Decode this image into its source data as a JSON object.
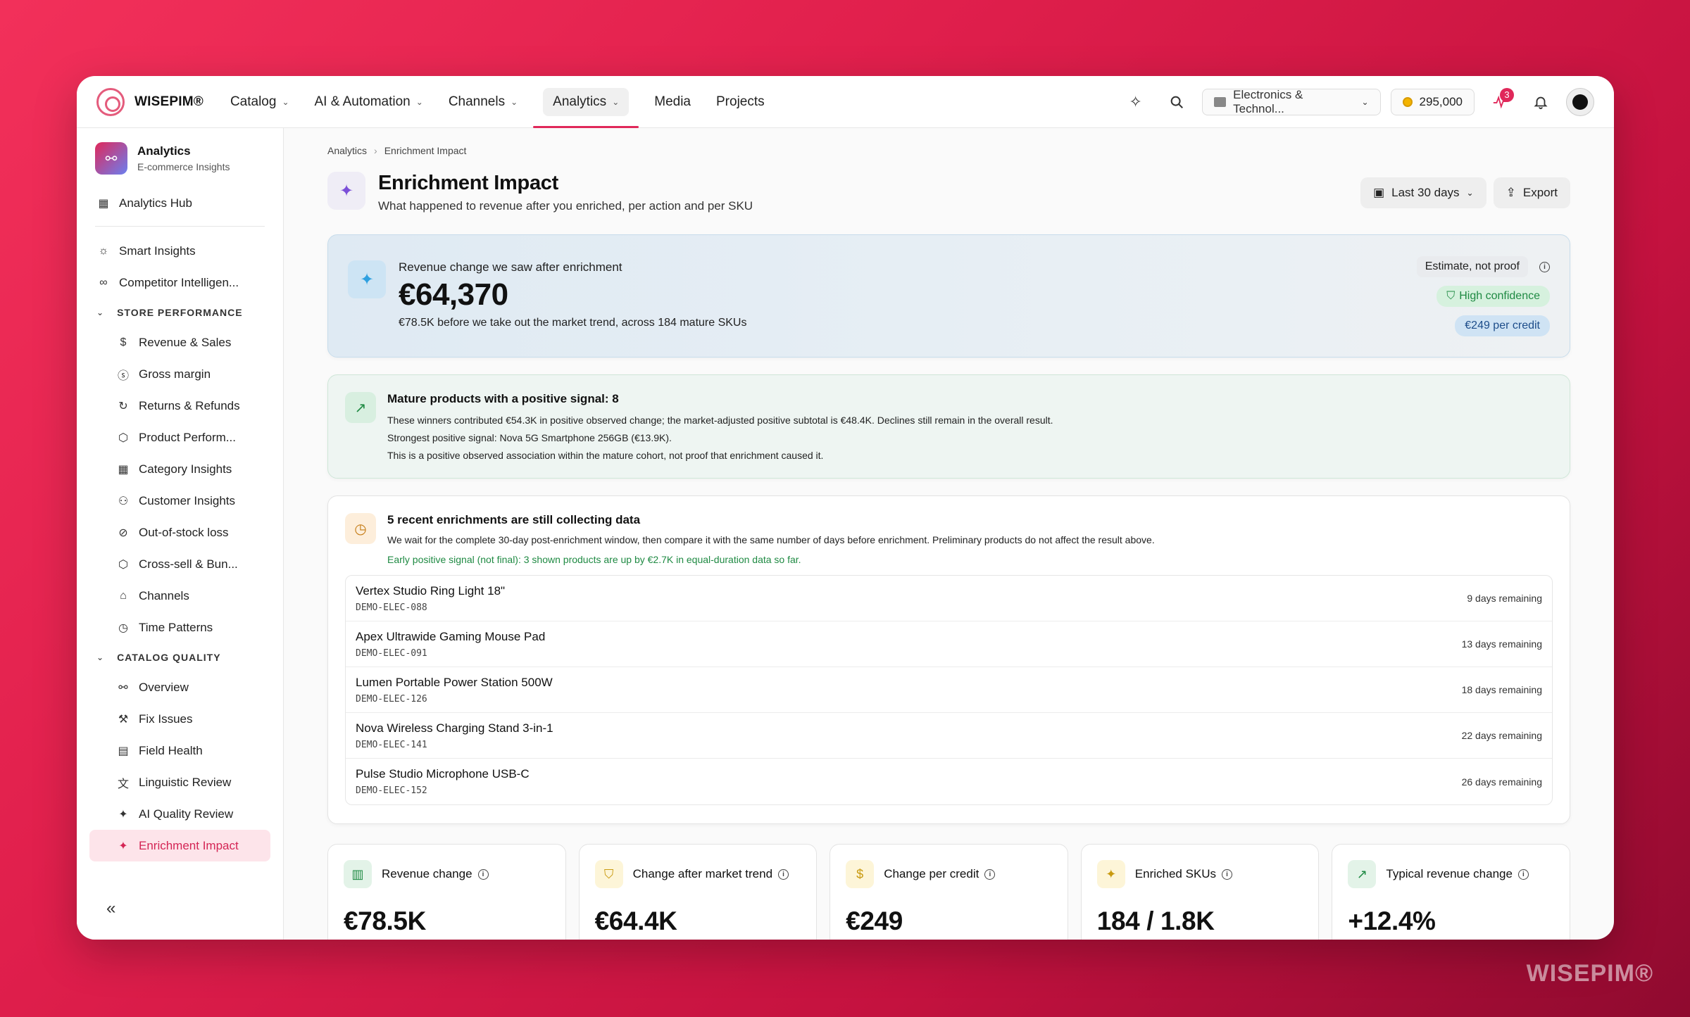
{
  "brand": {
    "name": "WISEPIM®"
  },
  "watermark": "WISEPIM®",
  "nav": {
    "items": [
      {
        "label": "Catalog",
        "dropdown": true
      },
      {
        "label": "AI & Automation",
        "dropdown": true
      },
      {
        "label": "Channels",
        "dropdown": true
      },
      {
        "label": "Analytics",
        "dropdown": true,
        "active": true
      },
      {
        "label": "Media",
        "dropdown": false
      },
      {
        "label": "Projects",
        "dropdown": false
      }
    ],
    "store": "Electronics & Technol...",
    "credits": "295,000",
    "activity_badge": "3"
  },
  "sidebar": {
    "title": "Analytics",
    "subtitle": "E-commerce Insights",
    "hub": "Analytics Hub",
    "top_items": [
      "Smart Insights",
      "Competitor Intelligen..."
    ],
    "store_performance": {
      "label": "STORE PERFORMANCE",
      "items": [
        "Revenue & Sales",
        "Gross margin",
        "Returns & Refunds",
        "Product Perform...",
        "Category Insights",
        "Customer Insights",
        "Out-of-stock loss",
        "Cross-sell & Bun...",
        "Channels",
        "Time Patterns"
      ]
    },
    "catalog_quality": {
      "label": "CATALOG QUALITY",
      "items": [
        "Overview",
        "Fix Issues",
        "Field Health",
        "Linguistic Review",
        "AI Quality Review",
        "Enrichment Impact"
      ]
    },
    "collapse": "«"
  },
  "breadcrumb": [
    "Analytics",
    "Enrichment Impact"
  ],
  "page": {
    "title": "Enrichment Impact",
    "subtitle": "What happened to revenue after you enriched, per action and per SKU",
    "date_range": "Last 30 days",
    "export": "Export"
  },
  "hero": {
    "label": "Revenue change we saw after enrichment",
    "value": "€64,370",
    "note": "€78.5K before we take out the market trend, across 184 mature SKUs",
    "estimate": "Estimate, not proof",
    "confidence": "High confidence",
    "per_credit": "€249 per credit"
  },
  "signal": {
    "title": "Mature products with a positive signal: 8",
    "lines": [
      "These winners contributed €54.3K in positive observed change; the market-adjusted positive subtotal is €48.4K. Declines still remain in the overall result.",
      "Strongest positive signal: Nova 5G Smartphone 256GB (€13.9K).",
      "This is a positive observed association within the mature cohort, not proof that enrichment caused it."
    ]
  },
  "collecting": {
    "title": "5 recent enrichments are still collecting data",
    "desc": "We wait for the complete 30-day post-enrichment window, then compare it with the same number of days before enrichment. Preliminary products do not affect the result above.",
    "early": "Early positive signal (not final): 3 shown products are up by €2.7K in equal-duration data so far.",
    "items": [
      {
        "name": "Vertex Studio Ring Light 18\"",
        "sku": "DEMO-ELEC-088",
        "remaining": "9 days remaining"
      },
      {
        "name": "Apex Ultrawide Gaming Mouse Pad",
        "sku": "DEMO-ELEC-091",
        "remaining": "13 days remaining"
      },
      {
        "name": "Lumen Portable Power Station 500W",
        "sku": "DEMO-ELEC-126",
        "remaining": "18 days remaining"
      },
      {
        "name": "Nova Wireless Charging Stand 3-in-1",
        "sku": "DEMO-ELEC-141",
        "remaining": "22 days remaining"
      },
      {
        "name": "Pulse Studio Microphone USB-C",
        "sku": "DEMO-ELEC-152",
        "remaining": "26 days remaining"
      }
    ]
  },
  "kpis": [
    {
      "label": "Revenue change",
      "value": "€78.5K",
      "icon": "bar-chart-icon",
      "bg": "#e3f3e8",
      "fg": "#1f8a43"
    },
    {
      "label": "Change after market trend",
      "value": "€64.4K",
      "icon": "shield-icon",
      "bg": "#fdf5d8",
      "fg": "#c99a10"
    },
    {
      "label": "Change per credit",
      "value": "€249",
      "icon": "coin-icon",
      "bg": "#fdf5d8",
      "fg": "#c99a10"
    },
    {
      "label": "Enriched SKUs",
      "value": "184 / 1.8K",
      "icon": "sparkle-icon",
      "bg": "#fdf5d8",
      "fg": "#c99a10"
    },
    {
      "label": "Typical revenue change",
      "value": "+12.4%",
      "icon": "trend-up-icon",
      "bg": "#e3f3e8",
      "fg": "#1f8a43"
    }
  ]
}
